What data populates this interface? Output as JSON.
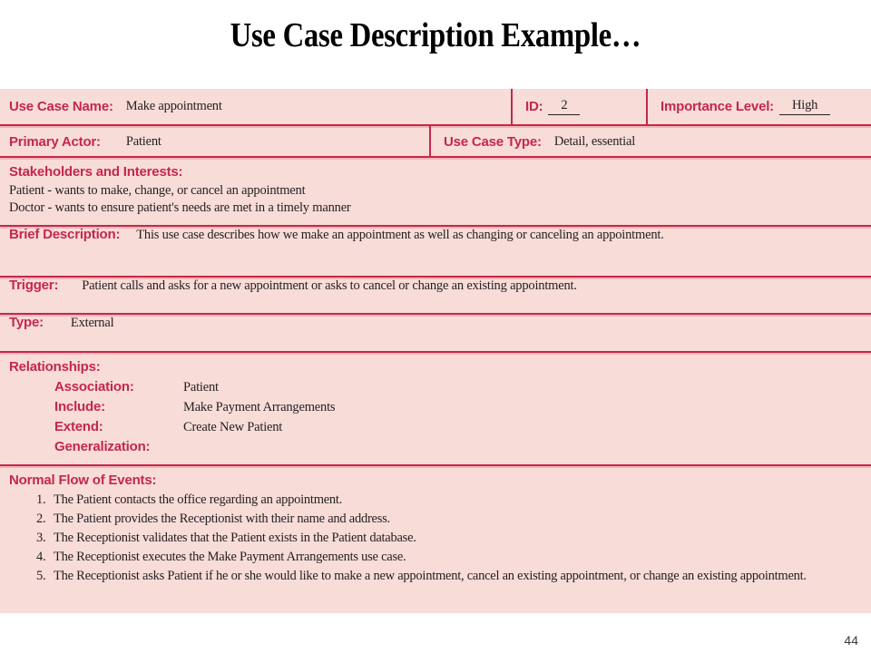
{
  "slide": {
    "title": "Use Case Description Example…",
    "page_number": "44"
  },
  "theme": {
    "table_background": "#f8dcd8",
    "rule_color": "#c4284a",
    "label_color": "#c4284a",
    "value_color": "#231f20",
    "title_color": "#000000"
  },
  "use_case": {
    "identity": {
      "name_label": "Use Case Name:",
      "name_value": "Make appointment",
      "id_label": "ID:",
      "id_value": "2",
      "importance_label": "Importance Level:",
      "importance_value": "High"
    },
    "actor": {
      "primary_actor_label": "Primary Actor:",
      "primary_actor_value": "Patient",
      "use_case_type_label": "Use Case Type:",
      "use_case_type_value": "Detail, essential"
    },
    "stakeholders": {
      "label": "Stakeholders and Interests:",
      "lines": [
        "Patient - wants to make, change, or cancel an appointment",
        "Doctor - wants to ensure patient's needs are met in a timely manner"
      ]
    },
    "brief_description": {
      "label": "Brief Description:",
      "value": "This use case describes how we make an appointment as well as changing or canceling an appointment."
    },
    "trigger": {
      "label": "Trigger:",
      "value": "Patient calls and asks for a new appointment or asks to cancel or change an existing appointment."
    },
    "type": {
      "label": "Type:",
      "value": "External"
    },
    "relationships": {
      "label": "Relationships:",
      "items": [
        {
          "label": "Association:",
          "value": "Patient"
        },
        {
          "label": "Include:",
          "value": "Make Payment Arrangements"
        },
        {
          "label": "Extend:",
          "value": "Create New Patient"
        },
        {
          "label": "Generalization:",
          "value": ""
        }
      ]
    },
    "normal_flow": {
      "label": "Normal Flow of Events:",
      "steps": [
        "The Patient contacts the office regarding an appointment.",
        "The Patient provides the Receptionist with their name and address.",
        "The Receptionist validates that the Patient exists in the Patient database.",
        "The Receptionist executes the Make Payment Arrangements use case.",
        "The Receptionist asks Patient if he or she would like to make a new appointment, cancel an existing appointment, or change an existing appointment."
      ]
    }
  }
}
